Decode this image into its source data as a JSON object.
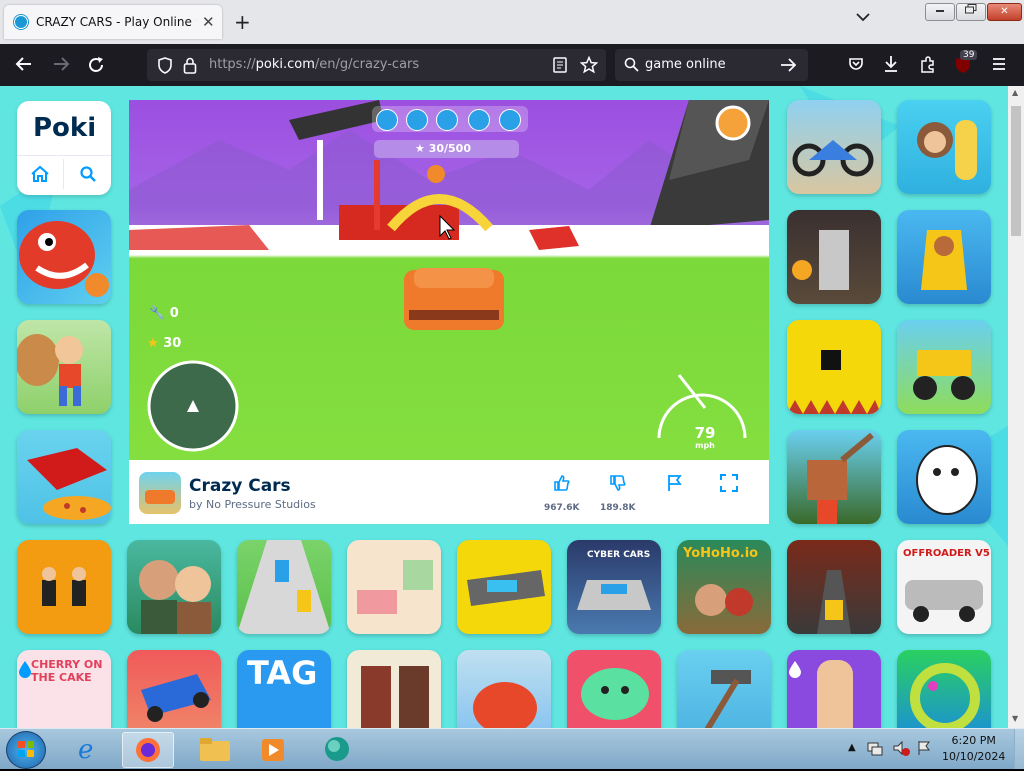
{
  "browser": {
    "tab_title": "CRAZY CARS - Play Online for Free!",
    "tab_close": "✕",
    "new_tab": "+",
    "tab_list": "⌄",
    "url_prefix": "https://",
    "url_host": "poki.com",
    "url_path": "/en/g/crazy-cars",
    "search_text": "game online",
    "extensions_badge": "39",
    "window_min": "▭",
    "window_max": "⧉",
    "window_close": "✕"
  },
  "site": {
    "logo": "Poki",
    "game": {
      "title": "Crazy Cars",
      "developer": "by No Pressure Studios",
      "likes": "967.6K",
      "dislikes": "189.8K",
      "hud": {
        "progress": "30/500",
        "wrenches": "0",
        "stars": "30",
        "speed": "79",
        "speed_unit": "mph"
      }
    },
    "tile_labels": {
      "cherry": "CHERRY ON THE CAKE",
      "tag": "TAG",
      "yohoho": "YoHoHo.io",
      "offroader": "OFFROADER V5",
      "cyber": "CYBER CARS"
    }
  },
  "taskbar": {
    "time": "6:20 PM",
    "date": "10/10/2024"
  },
  "colors": {
    "page_bg": "#5fe6e0",
    "poki_blue": "#009cff",
    "dark_text": "#002b50",
    "firefox_nav": "#1c1b22"
  }
}
